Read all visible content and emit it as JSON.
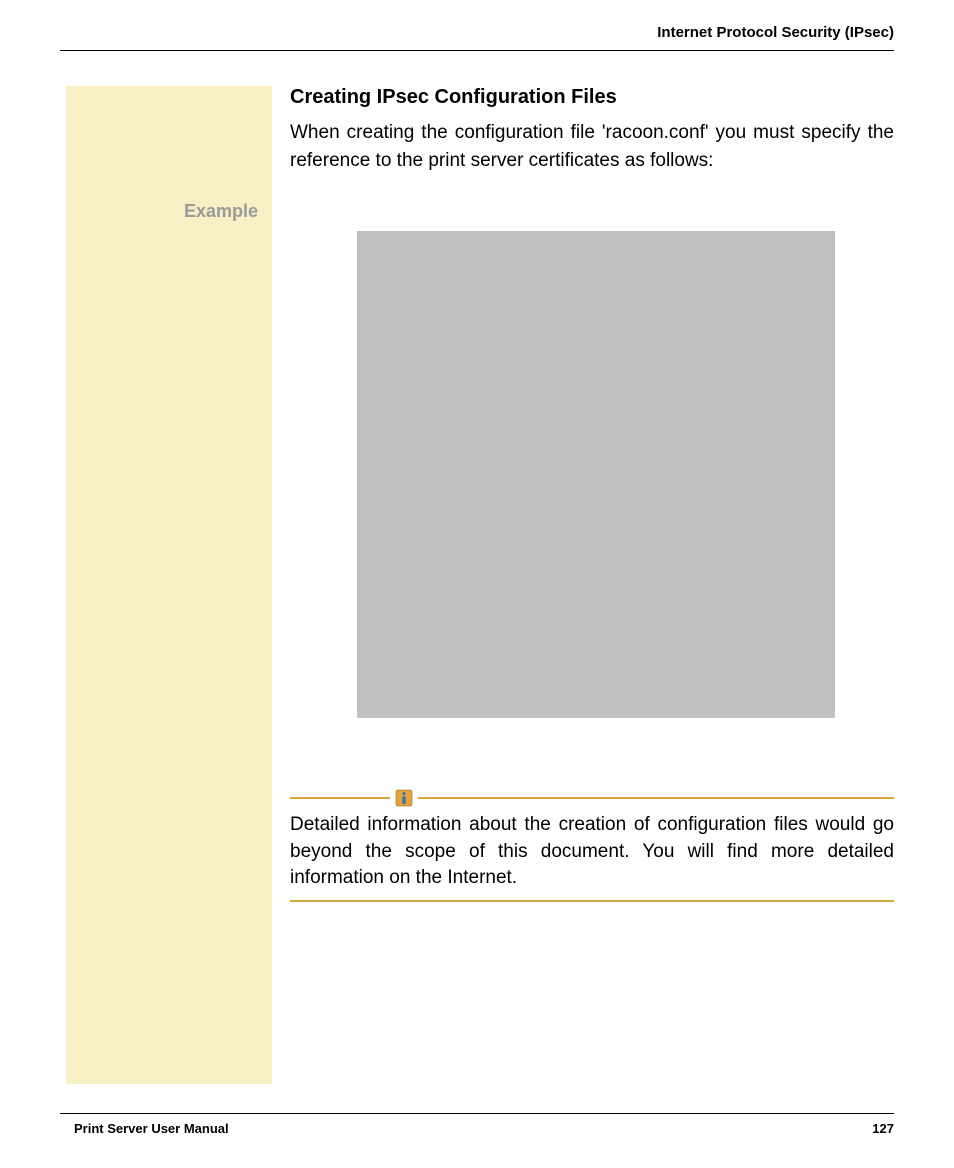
{
  "header": {
    "section_title": "Internet Protocol Security (IPsec)"
  },
  "sidebar": {
    "label": "Example"
  },
  "content": {
    "heading": "Creating IPsec Configuration Files",
    "intro_paragraph": "When creating the configuration file 'racoon.conf' you must specify the reference to the print server certificates as follows:",
    "note_text": "Detailed information about the creation of configuration files would go beyond the scope of this document. You will find more detailed information on the Internet."
  },
  "footer": {
    "manual_title": "Print Server User Manual",
    "page_number": "127"
  },
  "icons": {
    "info": "info-icon"
  }
}
